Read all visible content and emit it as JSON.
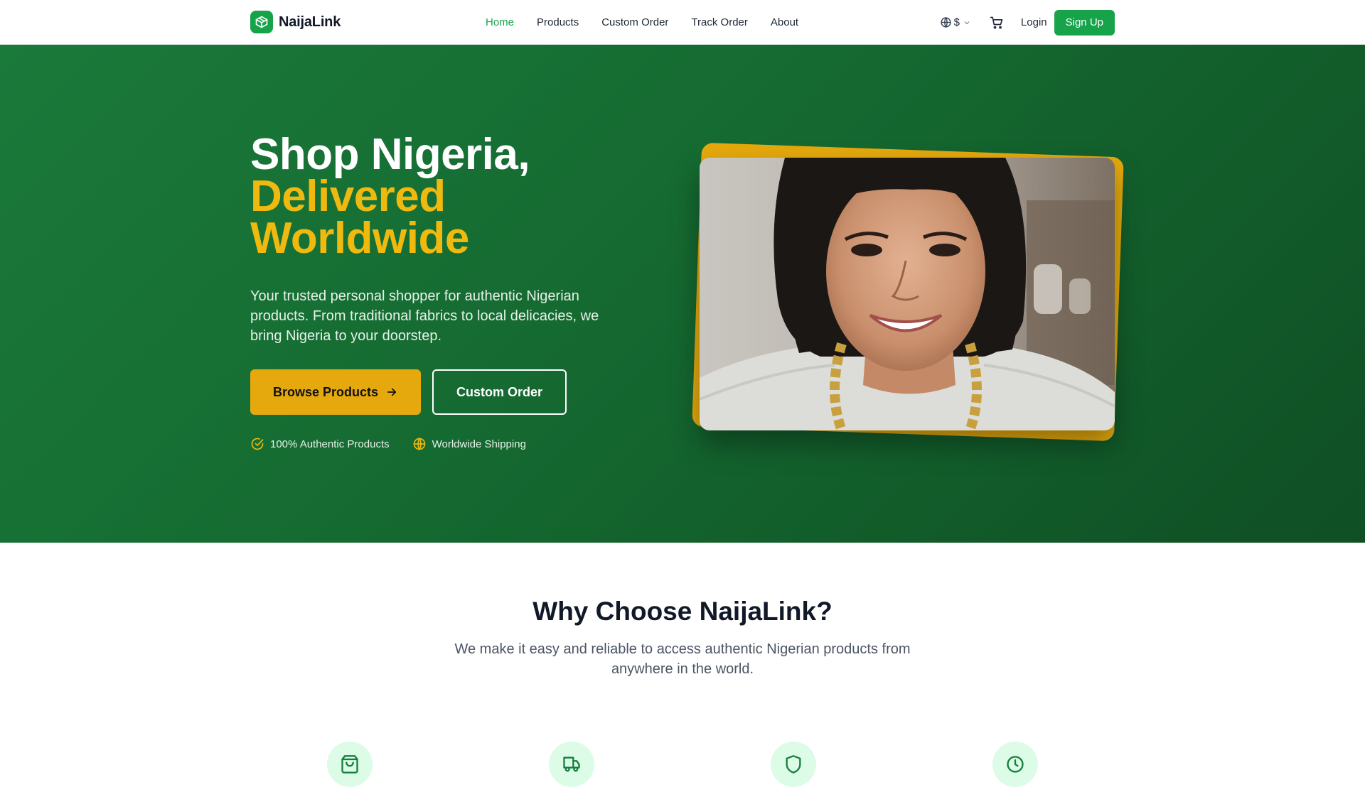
{
  "brand": {
    "name": "NaijaLink"
  },
  "nav": {
    "links": [
      {
        "label": "Home",
        "active": true
      },
      {
        "label": "Products"
      },
      {
        "label": "Custom Order"
      },
      {
        "label": "Track Order"
      },
      {
        "label": "About"
      }
    ],
    "currency": "$",
    "login": "Login",
    "signup": "Sign Up"
  },
  "hero": {
    "title_line1": "Shop Nigeria,",
    "title_line2": "Delivered",
    "title_line3": "Worldwide",
    "subtitle": "Your trusted personal shopper for authentic Nigerian products. From traditional fabrics to local delicacies, we bring Nigeria to your doorstep.",
    "browse_button": "Browse Products",
    "custom_button": "Custom Order",
    "badges": [
      "100% Authentic Products",
      "Worldwide Shipping"
    ]
  },
  "why": {
    "title": "Why Choose NaijaLink?",
    "subtitle": "We make it easy and reliable to access authentic Nigerian products from anywhere in the world."
  },
  "features": [
    {
      "icon": "shopping-bag-icon"
    },
    {
      "icon": "truck-icon"
    },
    {
      "icon": "shield-icon"
    },
    {
      "icon": "clock-icon"
    }
  ],
  "colors": {
    "brand_green": "#16a34a",
    "hero_green": "#156a31",
    "accent_yellow": "#e5a90d"
  }
}
